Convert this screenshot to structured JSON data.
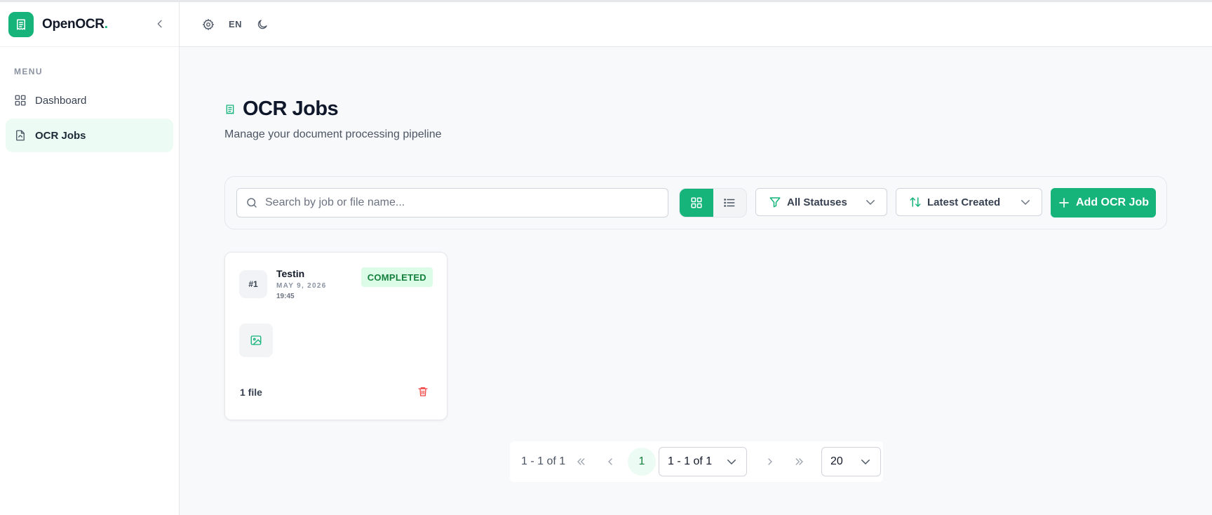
{
  "app": {
    "name": "OpenOCR",
    "name_dot": "."
  },
  "sidebar": {
    "menu_label": "MENU",
    "items": [
      {
        "label": "Dashboard",
        "icon": "grid-icon",
        "active": false
      },
      {
        "label": "OCR Jobs",
        "icon": "file-icon",
        "active": true
      }
    ]
  },
  "topbar": {
    "language": "EN"
  },
  "page": {
    "title": "OCR Jobs",
    "subtitle": "Manage your document processing pipeline"
  },
  "toolbar": {
    "search_placeholder": "Search by job or file name...",
    "status_filter": "All Statuses",
    "sort": "Latest Created",
    "add_button": "Add OCR Job"
  },
  "jobs": [
    {
      "number": "#1",
      "name": "Testin",
      "date": "MAY 9, 2026",
      "time": "19:45",
      "status": "COMPLETED",
      "files": "1 file"
    }
  ],
  "pagination": {
    "range": "1 - 1 of 1",
    "current_page": "1",
    "page_select": "1 - 1 of 1",
    "page_size": "20"
  },
  "colors": {
    "accent": "#16b47a",
    "accent_light": "#ecfbf4",
    "danger": "#ef4444",
    "status_completed_bg": "#dcfce7",
    "status_completed_text": "#15803d"
  }
}
